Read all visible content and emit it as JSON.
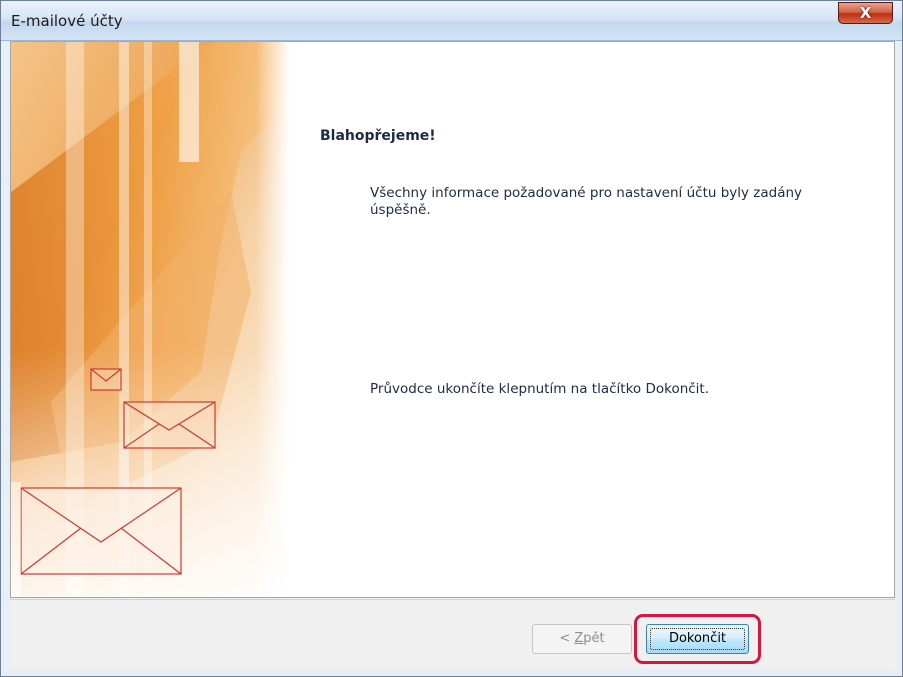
{
  "window": {
    "title": "E-mailové účty",
    "close_glyph": "X"
  },
  "content": {
    "heading": "Blahopřejeme!",
    "message_line1": "Všechny informace požadované pro nastavení účtu byly zadány",
    "message_line2": "úspěšně.",
    "instruction": "Průvodce ukončíte klepnutím na tlačítko Dokončit."
  },
  "buttons": {
    "back_prefix": "< ",
    "back_access_key": "Z",
    "back_rest": "pět",
    "back_enabled": false,
    "finish_label": "Dokončit"
  },
  "colors": {
    "banner_accent": "#e08a1e",
    "highlight_ring": "#d4183c",
    "text": "#1d2b45"
  },
  "icons": [
    "close-icon",
    "envelope-icon"
  ]
}
